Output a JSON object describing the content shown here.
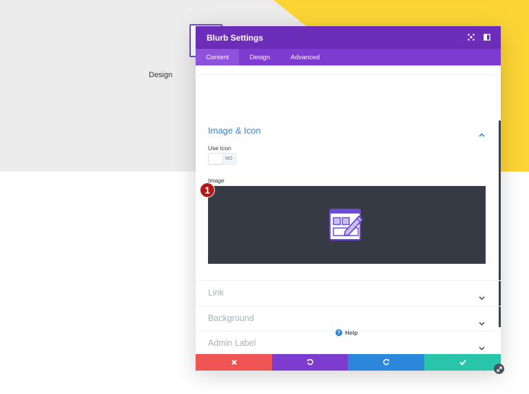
{
  "background": {
    "section_text": "Design",
    "colors": {
      "gray": "#ececec",
      "yellow": "#fcd535"
    }
  },
  "modal": {
    "title": "Blurb Settings",
    "header_icons": [
      "expand-icon",
      "sidebar-icon"
    ],
    "tabs": [
      {
        "label": "Content",
        "active": true
      },
      {
        "label": "Design",
        "active": false
      },
      {
        "label": "Advanced",
        "active": false
      }
    ],
    "sections": {
      "image_icon": {
        "title": "Image & Icon",
        "expanded": true,
        "use_icon": {
          "label": "Use Icon",
          "value": "NO"
        },
        "image": {
          "label": "Image",
          "step_badge": "1"
        }
      },
      "collapsed": [
        {
          "title": "Link"
        },
        {
          "title": "Background"
        },
        {
          "title": "Admin Label"
        }
      ]
    },
    "help": {
      "label": "Help",
      "icon": "?"
    },
    "footer": {
      "buttons": [
        "cancel-icon",
        "undo-icon",
        "redo-icon",
        "save-icon"
      ],
      "colors": {
        "cancel": "#ef5555",
        "undo": "#7e3bd0",
        "redo": "#2b87da",
        "save": "#29c4a9"
      }
    },
    "colors": {
      "header": "#6c2eb9",
      "tabs": "#7e3bd0",
      "accent": "#2b87da"
    }
  }
}
